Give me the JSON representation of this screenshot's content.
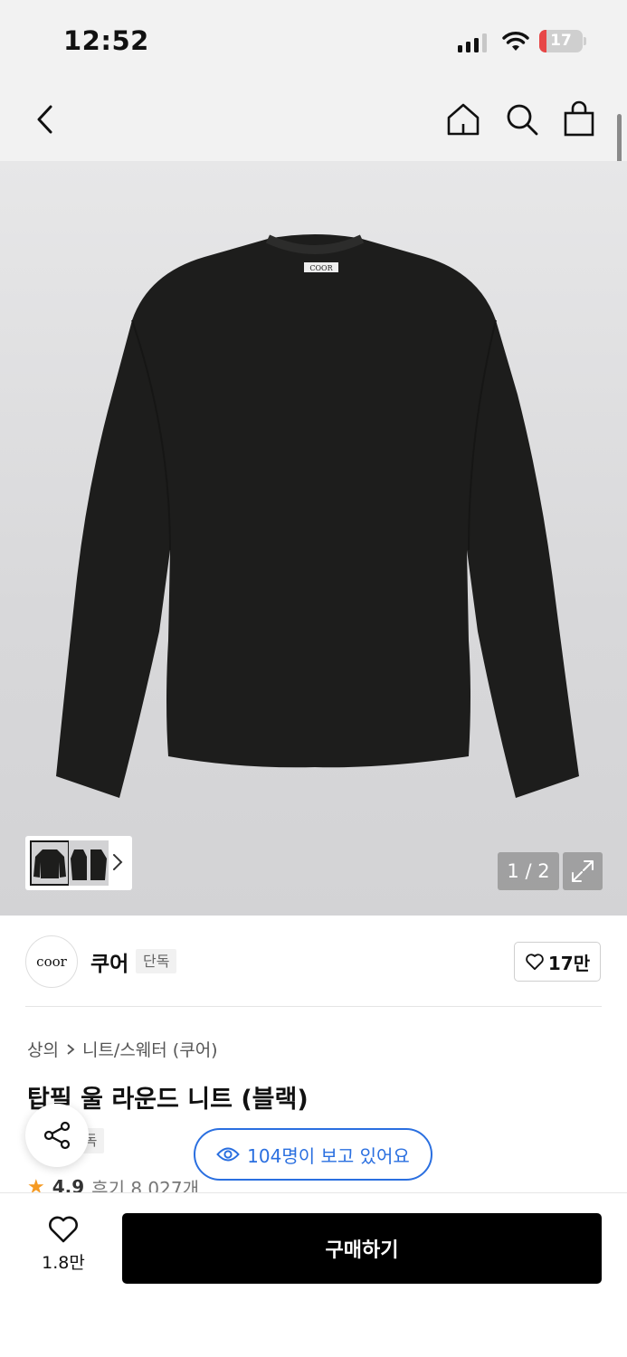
{
  "status_bar": {
    "time": "12:52",
    "battery": "17",
    "battery_level_percent": 17
  },
  "nav": {
    "back_icon": "chevron-left-icon",
    "home_icon": "home-icon",
    "search_icon": "search-icon",
    "cart_icon": "shopping-bag-icon"
  },
  "gallery": {
    "page_indicator": "1 / 2",
    "expand_icon": "expand-icon",
    "thumbnail_arrow_icon": "chevron-right-icon",
    "logo_tag": "COOR"
  },
  "brand": {
    "logo_text": "coor",
    "name": "쿠어",
    "badge": "단독",
    "likes": "17만"
  },
  "breadcrumb": {
    "category": "상의",
    "subcategory": "니트/스웨터 (쿠어)"
  },
  "product": {
    "title": "탑필 울 라운드 니트 (블랙)",
    "badge": "단독",
    "rating": "4.9",
    "reviews": "후기 8,027개"
  },
  "overlay": {
    "viewers": "104명이 보고 있어요",
    "share_icon": "share-icon"
  },
  "bottom_bar": {
    "wish_count": "1.8만",
    "buy_label": "구매하기"
  },
  "colors": {
    "accent_blue": "#2a6fe0",
    "buy_button": "#000000",
    "battery_low": "#e74646",
    "star": "#f59a23"
  }
}
